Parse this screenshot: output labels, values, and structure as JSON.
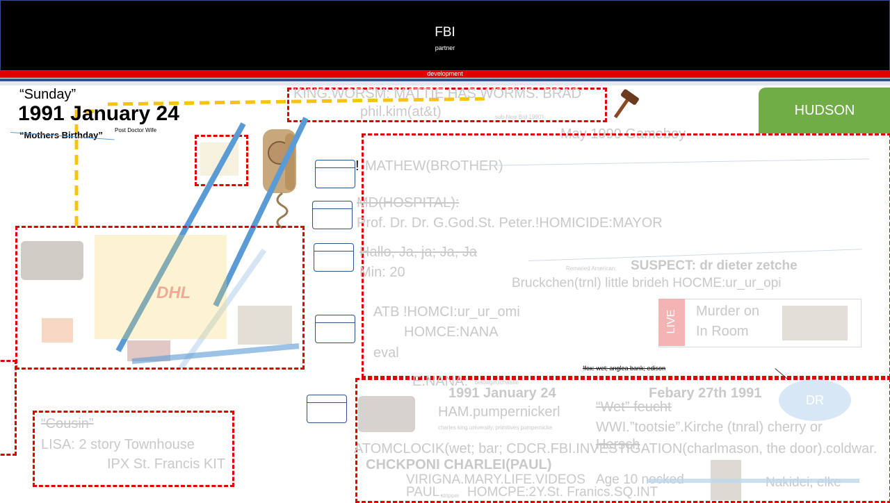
{
  "header": {
    "title": "FBI",
    "subtitle": "partner",
    "bar_label": "development"
  },
  "date_block": {
    "day": "“Sunday”",
    "date": "1991 January 24",
    "note": "“Mothers Birthday”",
    "note_small": "Post Doctor Wife"
  },
  "top_box": {
    "line1": "KING.WORSM: MATTIE HAS WORMS.   BRAD",
    "line2": "phil.kim(at&t)",
    "tiny": "sub-New Brd 1990’l"
  },
  "gameboy": "May 1990 Gameboy",
  "hudson": "HUDSON",
  "main_list": {
    "mathew": "MATHEW(BROTHER)",
    "md": "MD(HOSPITAL):",
    "prof": "Prof. Dr. Dr. G.God.St. Peter.!HOMICIDE:MAYOR",
    "hallo": "Hallo, Ja, ja;   Ja, Ja",
    "min": "Min: 20",
    "atb": "ATB !HOMCI:ur_ur_omi",
    "nana": "HOMCE:NANA",
    "eval": "eval",
    "suspect_prefix": "Remaried American:",
    "suspect": "SUSPECT: dr dieter zetche",
    "bruck": "Bruckchen(trnl) little brideh HOCME:ur_ur_opi"
  },
  "live_card": {
    "badge": "LIVE",
    "line1": "Murder on",
    "line2": "In Room"
  },
  "fox_line": "!fox: wet; anglea bank; edison",
  "bottom_left": {
    "cousin": "“Cousin”",
    "lisa": "LISA: 2 story Townhouse",
    "ipx": "IPX St. Francis KIT"
  },
  "bottom_right": {
    "enana": "E.NANA:",
    "enana_small": "belowgirl;ichwaffe",
    "date": "1991 January 24",
    "ham": "HAM.pumpernickerl",
    "ham_small": "charles king university, primitives pumpernicke",
    "febary": "Febary 27th 1991",
    "wet": "“Wet” feucht",
    "wwi": "WWI.”tootsie”.Kirche (tnral) cherry or",
    "hersch": "Hersch",
    "atomc": "ATOMCLOCIK(wet; bar; CDCR.FBI.INVESTIGATION(charlmason, the door).coldwar.",
    "chckponi": "CHCKPONI CHARLEI(PAUL)",
    "viragna": "VIRIGNA.MARY.LIFE.VIDEOS",
    "age": "Age 10 nocked",
    "paul": "PAUL.",
    "paul_small": "stripper",
    "homcpe": "HOMCPE:2Y.St. Franics.SQ.INT",
    "nakidei": "Nakidei; elke",
    "dr": "DR"
  },
  "colors": {
    "header_bg": "#000000",
    "accent_red": "#e00000",
    "hudson_green": "#70ad47",
    "dash_yellow": "#f5c000",
    "stripe_blue": "#5b9bd5"
  },
  "icons": [
    "gavel-icon",
    "telephone-image",
    "pumpernickel-image",
    "dhl-box-image"
  ]
}
